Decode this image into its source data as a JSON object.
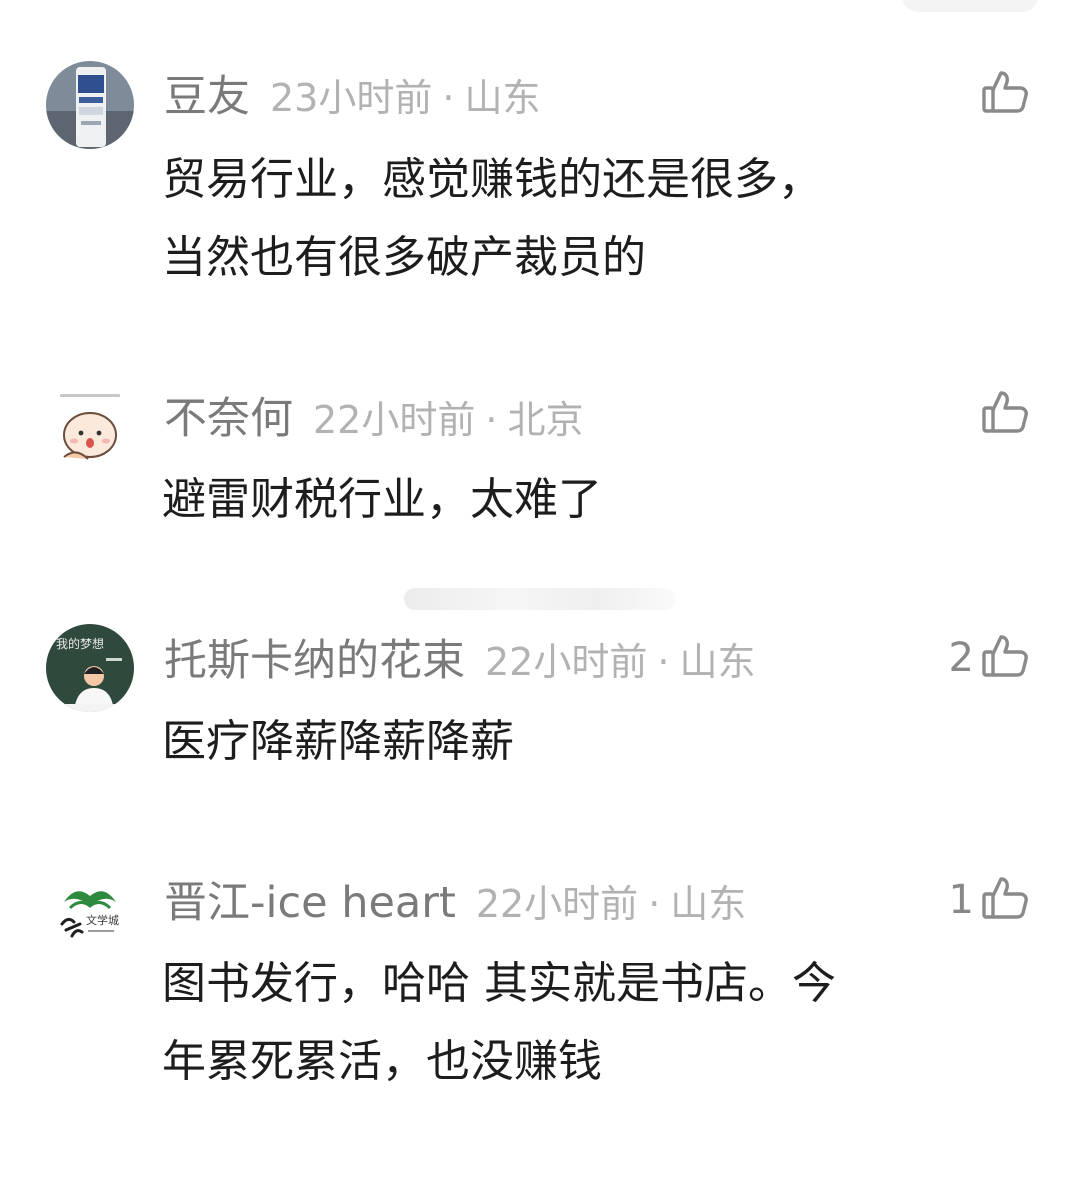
{
  "colors": {
    "username": "#7a7a7a",
    "meta": "#b2b2b2",
    "body_text": "#1d1d1d",
    "like_icon": "#8a8a8a"
  },
  "comments": [
    {
      "username": "豆友",
      "time": "23小时前",
      "separator": "·",
      "location": "山东",
      "text_lines": [
        "贸易行业，感觉赚钱的还是很多，",
        "当然也有很多破产裁员的"
      ],
      "likes": "",
      "like_icon": "thumbs-up-icon",
      "avatar_icon": "drink-can-photo"
    },
    {
      "username": "不奈何",
      "time": "22小时前",
      "separator": "·",
      "location": "北京",
      "text_lines": [
        "避雷财税行业，太难了"
      ],
      "likes": "",
      "like_icon": "thumbs-up-icon",
      "avatar_icon": "cartoon-face"
    },
    {
      "username": "托斯卡纳的花束",
      "time": "22小时前",
      "separator": "·",
      "location": "山东",
      "text_lines": [
        "医疗降薪降薪降薪"
      ],
      "likes": "2",
      "like_icon": "thumbs-up-icon",
      "avatar_icon": "child-blackboard-photo"
    },
    {
      "username": "晋江-ice heart",
      "time": "22小时前",
      "separator": "·",
      "location": "山东",
      "text_lines": [
        "图书发行，哈哈 其实就是书店。今",
        "年累死累活，也没赚钱"
      ],
      "likes": "1",
      "like_icon": "thumbs-up-icon",
      "avatar_icon": "bookstore-logo"
    }
  ]
}
